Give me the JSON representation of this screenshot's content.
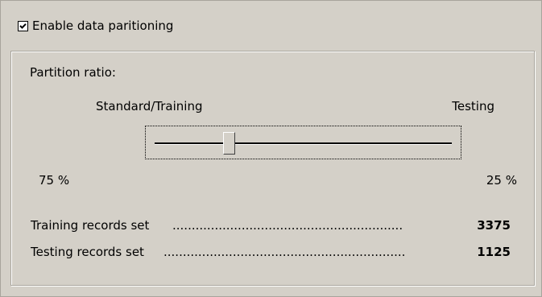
{
  "enable": {
    "label": "Enable data paritioning",
    "checked": true
  },
  "partition": {
    "title": "Partition ratio:",
    "left_label": "Standard/Training",
    "right_label": "Testing",
    "slider_value_percent": 25,
    "training_percent": "75  %",
    "testing_percent": "25  %"
  },
  "records": [
    {
      "label": "Training records set",
      "dots": "............................................................",
      "value": "3375"
    },
    {
      "label": "Testing records set",
      "dots": "...............................................................",
      "value": "1125"
    }
  ]
}
